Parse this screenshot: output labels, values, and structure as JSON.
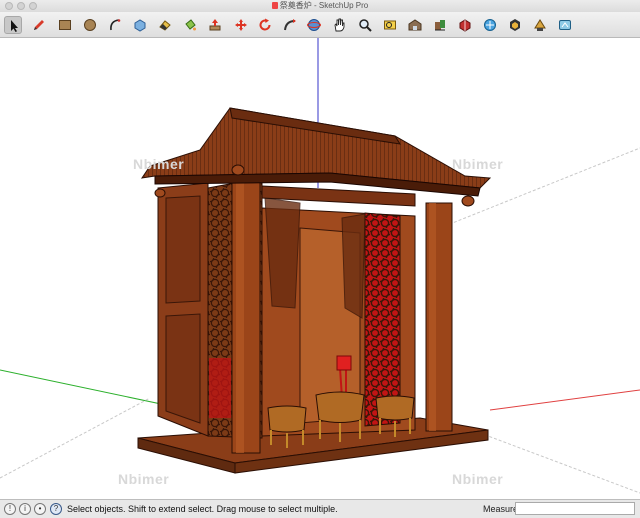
{
  "window": {
    "title": "祭奠香炉 - SketchUp Pro"
  },
  "toolbar": {
    "tools": [
      {
        "name": "select-tool-button",
        "icon": "arrow-pointer-icon",
        "active": true
      },
      {
        "name": "line-tool-button",
        "icon": "pencil-icon"
      },
      {
        "name": "rectangle-tool-button",
        "icon": "rectangle-icon"
      },
      {
        "name": "circle-tool-button",
        "icon": "circle-icon"
      },
      {
        "name": "arc-tool-button",
        "icon": "arc-icon"
      },
      {
        "name": "make-component-button",
        "icon": "component-icon"
      },
      {
        "name": "eraser-tool-button",
        "icon": "eraser-icon"
      },
      {
        "name": "paint-bucket-tool-button",
        "icon": "paint-bucket-icon"
      },
      {
        "name": "push-pull-tool-button",
        "icon": "push-pull-icon"
      },
      {
        "name": "move-tool-button",
        "icon": "move-arrows-icon"
      },
      {
        "name": "rotate-tool-button",
        "icon": "rotate-icon"
      },
      {
        "name": "follow-me-tool-button",
        "icon": "follow-me-icon"
      },
      {
        "name": "orbit-tool-button",
        "icon": "orbit-icon"
      },
      {
        "name": "pan-tool-button",
        "icon": "hand-icon"
      },
      {
        "name": "zoom-tool-button",
        "icon": "magnifier-icon"
      },
      {
        "name": "zoom-extents-button",
        "icon": "zoom-extents-icon"
      },
      {
        "name": "3d-warehouse-button",
        "icon": "warehouse-icon"
      },
      {
        "name": "share-model-button",
        "icon": "share-model-icon"
      },
      {
        "name": "extension-warehouse-button",
        "icon": "extension-icon"
      },
      {
        "name": "layout-button",
        "icon": "layout-icon"
      },
      {
        "name": "get-models-button",
        "icon": "get-models-icon"
      },
      {
        "name": "style-builder-button",
        "icon": "style-icon"
      }
    ]
  },
  "viewport": {
    "watermark_text": "Nbimer",
    "axis_colors": {
      "red": "#e04040",
      "green": "#2cb02c",
      "blue": "#3535c8"
    }
  },
  "statusbar": {
    "message": "Select objects. Shift to extend select. Drag mouse to select multiple.",
    "measurements_label": "Measurements",
    "measurements_value": ""
  }
}
